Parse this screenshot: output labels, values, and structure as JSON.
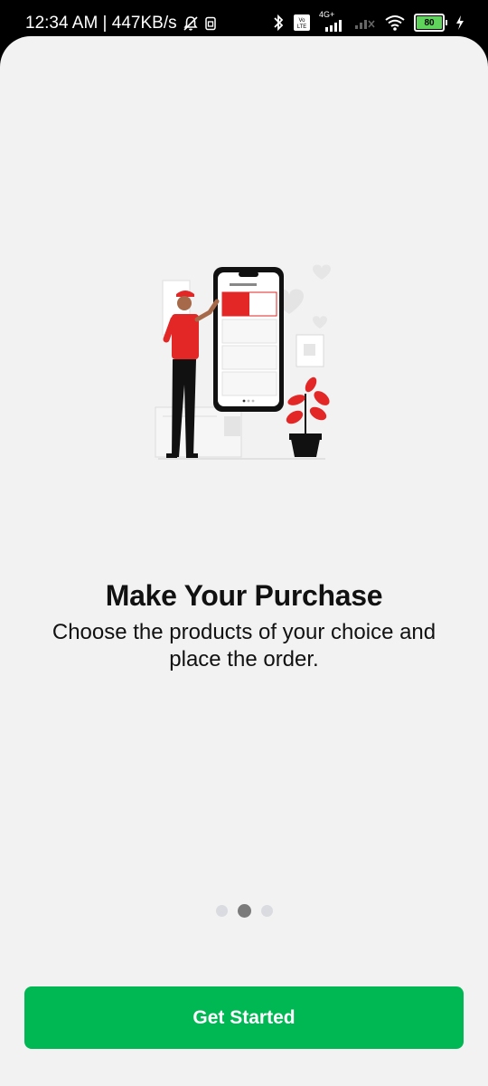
{
  "status_bar": {
    "time_speed": "12:34 AM | 447KB/s",
    "network": "4G+",
    "battery": "80"
  },
  "onboarding": {
    "title": "Make Your Purchase",
    "subtitle": "Choose the products of your choice and place the order.",
    "illustration": "person-ordering-on-phone-illustration",
    "page_indicator": {
      "total": 3,
      "active": 2
    }
  },
  "cta": {
    "label": "Get Started"
  },
  "colors": {
    "accent": "#00b853",
    "brand_red": "#e32626",
    "background": "#f2f2f2",
    "dot_active": "#7b7b7b",
    "dot_inactive": "#d9dbe0"
  }
}
